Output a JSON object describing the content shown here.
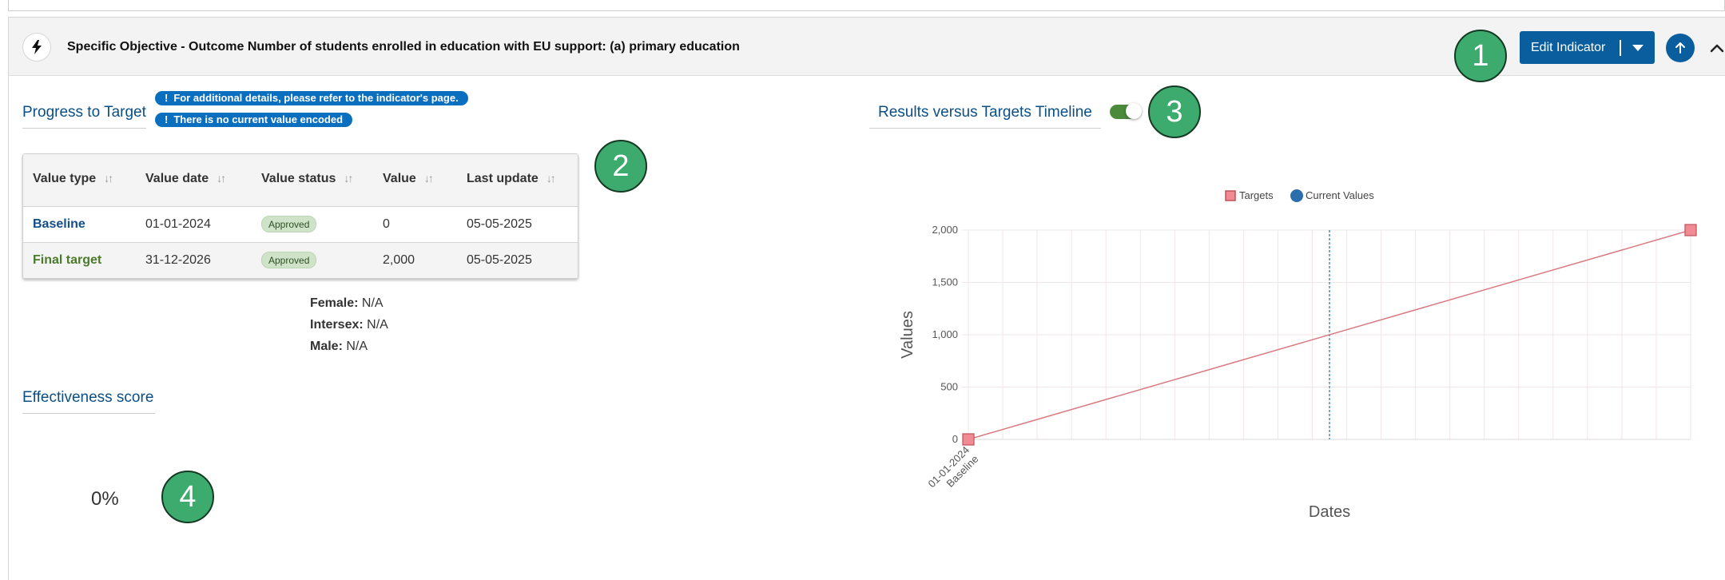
{
  "header": {
    "title": "Specific Objective - Outcome Number of students enrolled in education with EU support: (a) primary education",
    "edit_button_label": "Edit Indicator"
  },
  "callouts": [
    "1",
    "2",
    "3",
    "4"
  ],
  "progress": {
    "title": "Progress to Target",
    "notice_1": "For additional details, please refer to the indicator's page.",
    "notice_2": "There is no current value encoded",
    "notice_icon": "!",
    "table": {
      "columns": [
        "Value type",
        "Value date",
        "Value status",
        "Value",
        "Last update"
      ],
      "sort_icon": "↓↑",
      "rows": [
        {
          "type": "Baseline",
          "date": "01-01-2024",
          "status": "Approved",
          "value": "0",
          "updated": "05-05-2025"
        },
        {
          "type": "Final target",
          "date": "31-12-2026",
          "status": "Approved",
          "value": "2,000",
          "updated": "05-05-2025"
        }
      ]
    },
    "disaggregation": [
      {
        "label": "Female:",
        "value": "N/A"
      },
      {
        "label": "Intersex:",
        "value": "N/A"
      },
      {
        "label": "Male:",
        "value": "N/A"
      }
    ]
  },
  "effectiveness": {
    "title": "Effectiveness score",
    "value": "0%"
  },
  "timeline": {
    "title": "Results versus Targets Timeline",
    "toggle_on": true
  },
  "colors": {
    "primary": "#0b5e9e",
    "callout": "#3dab6e",
    "target_series": "#d97a80",
    "current_series": "#2a6fab"
  },
  "chart_data": {
    "type": "line",
    "legend": [
      "Targets",
      "Current Values"
    ],
    "legend_position": "top",
    "xlabel": "Dates",
    "ylabel": "Values",
    "ylim": [
      0,
      2000
    ],
    "yticks": [
      "2,000",
      "1,500",
      "1,000",
      "500",
      "0"
    ],
    "x_tick_label_lines": [
      "01-01-2024",
      "Baseline"
    ],
    "series": [
      {
        "name": "Targets",
        "points": [
          {
            "x": "01-01-2024",
            "y": 0
          },
          {
            "x": "31-12-2026",
            "y": 2000
          }
        ]
      },
      {
        "name": "Current Values",
        "points": []
      }
    ],
    "today_marker": true,
    "grid": true
  }
}
